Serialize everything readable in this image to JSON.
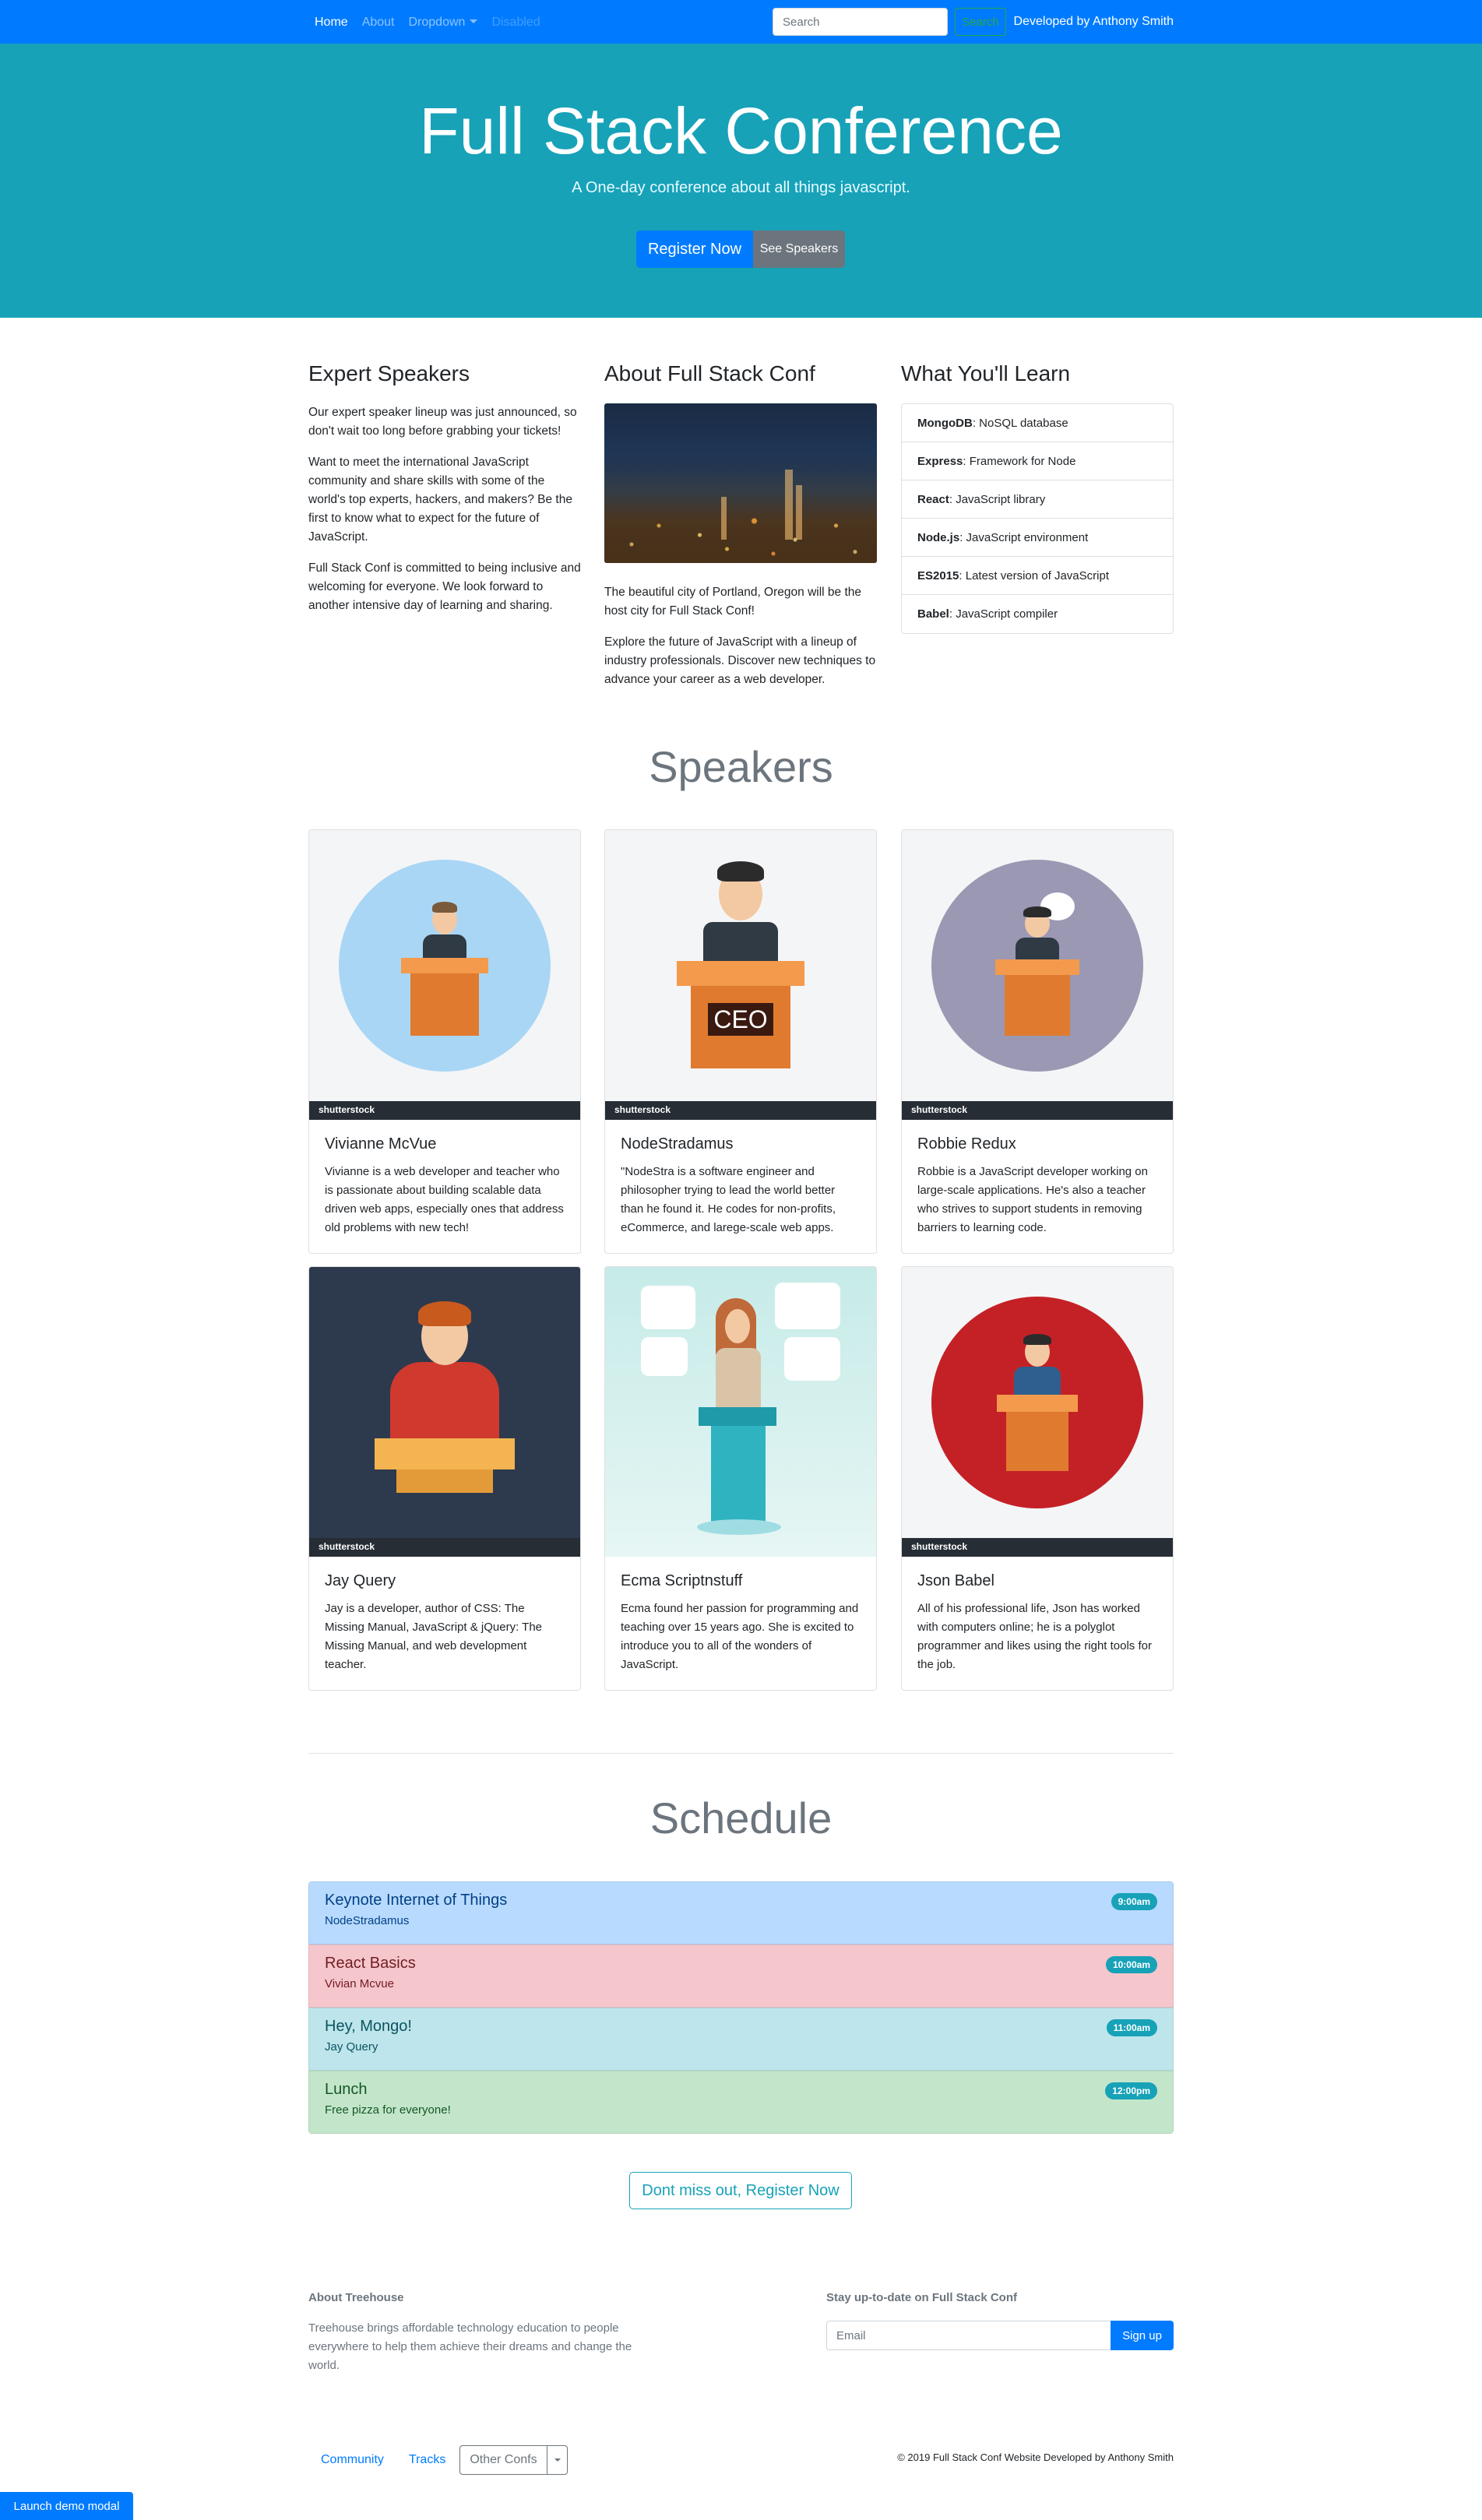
{
  "navbar": {
    "links": [
      "Home",
      "About",
      "Dropdown",
      "Disabled"
    ],
    "search_placeholder": "Search",
    "search_button": "Search",
    "developer": "Developed by Anthony Smith"
  },
  "jumbotron": {
    "title": "Full Stack Conference",
    "lead": "A One-day conference about all things javascript.",
    "register_button": "Register Now",
    "speakers_button": "See Speakers"
  },
  "columns": {
    "expert": {
      "title": "Expert Speakers",
      "p1": "Our expert speaker lineup was just announced, so don't wait too long before grabbing your tickets!",
      "p2": "Want to meet the international JavaScript community and share skills with some of the world's top experts, hackers, and makers? Be the first to know what to expect for the future of JavaScript.",
      "p3": "Full Stack Conf is committed to being inclusive and welcoming for everyone. We look forward to another intensive day of learning and sharing."
    },
    "about": {
      "title": "About Full Stack Conf",
      "p1": "The beautiful city of Portland, Oregon will be the host city for Full Stack Conf!",
      "p2": "Explore the future of JavaScript with a lineup of industry professionals. Discover new techniques to advance your career as a web developer."
    },
    "learn": {
      "title": "What You'll Learn",
      "items": [
        {
          "name": "MongoDB",
          "desc": ": NoSQL database"
        },
        {
          "name": "Express",
          "desc": ": Framework for Node"
        },
        {
          "name": "React",
          "desc": ": JavaScript library"
        },
        {
          "name": "Node.js",
          "desc": ": JavaScript environment"
        },
        {
          "name": "ES2015",
          "desc": ": Latest version of JavaScript"
        },
        {
          "name": "Babel",
          "desc": ": JavaScript compiler"
        }
      ]
    }
  },
  "speakers": {
    "title": "Speakers",
    "watermark": "shutterstock",
    "cards": [
      {
        "name": "Vivianne McVue",
        "bio": "Vivianne is a web developer and teacher who is passionate about building scalable data driven web apps, especially ones that address old problems with new tech!"
      },
      {
        "name": "NodeStradamus",
        "bio": "\"NodeStra is a software engineer and philosopher trying to lead the world better than he found it. He codes for non-profits, eCommerce, and larege-scale web apps.",
        "podium_text": "CEO"
      },
      {
        "name": "Robbie Redux",
        "bio": "Robbie is a JavaScript developer working on large-scale applications. He's also a teacher who strives to support students in removing barriers to learning code."
      },
      {
        "name": "Jay Query",
        "bio": "Jay is a developer, author of CSS: The Missing Manual, JavaScript & jQuery: The Missing Manual, and web development teacher."
      },
      {
        "name": "Ecma Scriptnstuff",
        "bio": "Ecma found her passion for programming and teaching over 15 years ago. She is excited to introduce you to all of the wonders of JavaScript."
      },
      {
        "name": "Json Babel",
        "bio": "All of his professional life, Json has worked with computers online; he is a polyglot programmer and likes using the right tools for the job."
      }
    ]
  },
  "schedule": {
    "title": "Schedule",
    "items": [
      {
        "title": "Keynote Internet of Things",
        "sub": "NodeStradamus",
        "time": "9:00am"
      },
      {
        "title": "React Basics",
        "sub": "Vivian Mcvue",
        "time": "10:00am"
      },
      {
        "title": "Hey, Mongo!",
        "sub": "Jay Query",
        "time": "11:00am"
      },
      {
        "title": "Lunch",
        "sub": "Free pizza for everyone!",
        "time": "12:00pm"
      }
    ],
    "cta": "Dont miss out, Register Now"
  },
  "footer": {
    "about_title": "About Treehouse",
    "about_text": "Treehouse brings affordable technology education to people everywhere to help them achieve their dreams and change the world.",
    "news_title": "Stay up-to-date on Full Stack Conf",
    "email_placeholder": "Email",
    "signup": "Sign up",
    "links": [
      "Community",
      "Tracks"
    ],
    "dropdown": "Other Confs",
    "copyright": "© 2019 Full Stack Conf Website Developed by Anthony Smith"
  },
  "modal_button": "Launch demo modal",
  "colors": {
    "primary": "#007bff",
    "info": "#17a2b8",
    "secondary": "#6c757d"
  }
}
